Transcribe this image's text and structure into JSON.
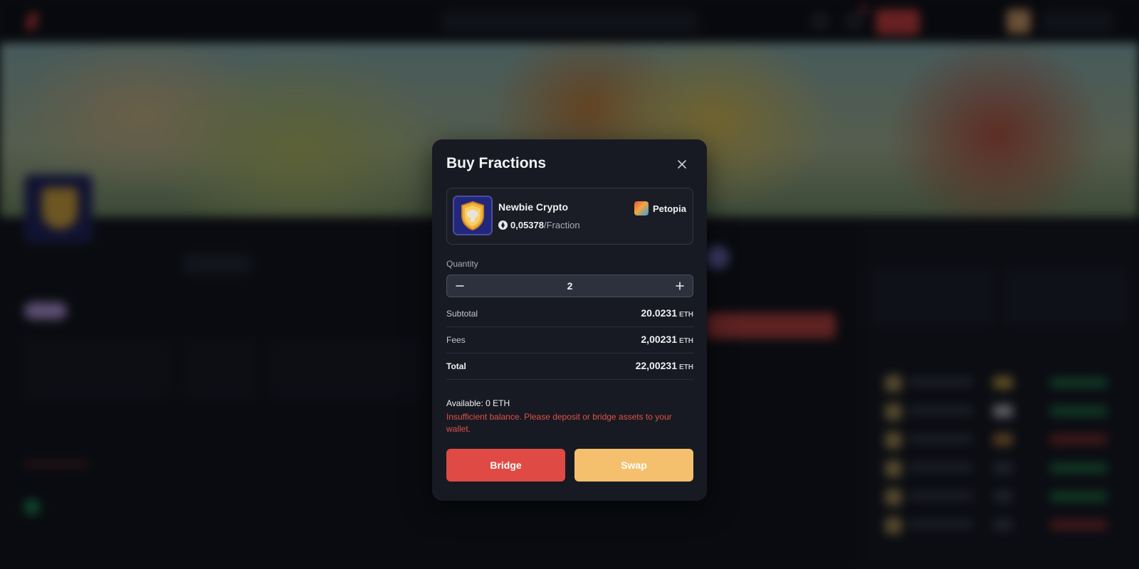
{
  "modal": {
    "title": "Buy Fractions",
    "item": {
      "name": "Newbie Crypto",
      "price": "0,05378",
      "price_unit": "/Fraction",
      "game": "Petopia"
    },
    "quantity": {
      "label": "Quantity",
      "value": "2"
    },
    "summary": [
      {
        "label": "Subtotal",
        "value": "20.0231",
        "unit": "ETH"
      },
      {
        "label": "Fees",
        "value": "2,00231",
        "unit": "ETH"
      },
      {
        "label": "Total",
        "value": "22,00231",
        "unit": "ETH"
      }
    ],
    "available": "Available: 0 ETH",
    "error": "Insufficient balance. Please deposit or bridge assets to your wallet.",
    "buttons": {
      "bridge": "Bridge",
      "swap": "Swap"
    }
  },
  "colors": {
    "accent_red": "#e04a45",
    "accent_gold": "#f4c06d",
    "error_text": "#e0504a",
    "modal_bg": "#171a22"
  },
  "icons": {
    "close": "close-icon",
    "minus": "minus-icon",
    "plus": "plus-icon",
    "currency": "eth-coin-icon",
    "game": "petopia-game-icon",
    "item": "shield-badge-icon"
  }
}
